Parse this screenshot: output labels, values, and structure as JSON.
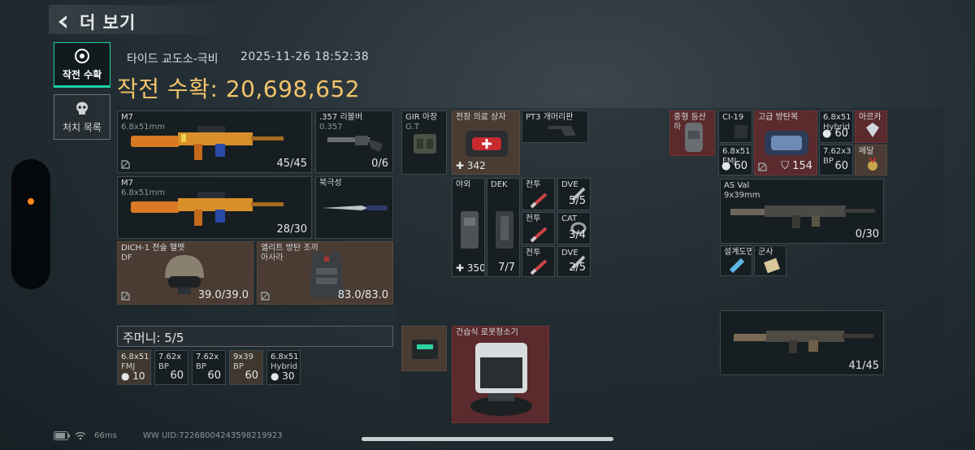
{
  "header": {
    "back_label": "더 보기"
  },
  "tabs": [
    {
      "label": "작전 수확",
      "active": true,
      "icon": "raid-harvest-icon"
    },
    {
      "label": "처치 목록",
      "active": false,
      "icon": "skull-icon"
    }
  ],
  "raid": {
    "location": "타이드 교도소-극비",
    "datetime": "2025-11-26 18:52:38",
    "harvest_label": "작전 수확:",
    "harvest_value": "20,698,652"
  },
  "left": {
    "weapon1": {
      "name": "M7",
      "caliber": "6.8x51mm",
      "ammo": "45/45"
    },
    "sidearm": {
      "name": ".357 리볼버",
      "sub": "0.357",
      "ammo": "0/6"
    },
    "weapon2": {
      "name": "M7",
      "caliber": "6.8x51mm",
      "ammo": "28/30"
    },
    "melee": {
      "name": "북극성"
    },
    "helmet": {
      "name": "DICH-1 전술 헬멧",
      "sub": "DF",
      "durability": "39.0/39.0"
    },
    "armor": {
      "name": "엘리트 방탄 조끼",
      "sub": "아사라",
      "durability": "83.0/83.0"
    },
    "pockets_label": "주머니: 5/5",
    "pockets": [
      {
        "name": "6.8x51",
        "sub": "FMJ",
        "count": "10"
      },
      {
        "name": "7.62x",
        "sub": "BP",
        "count": "60"
      },
      {
        "name": "7.62x",
        "sub": "BP",
        "count": "60"
      },
      {
        "name": "9x39",
        "sub": "BP",
        "count": "60"
      },
      {
        "name": "6.8x51",
        "sub": "Hybrid",
        "count": "30"
      }
    ]
  },
  "middle": {
    "rig": {
      "name": "GIR 아장",
      "sub": "G.T"
    },
    "medkit": {
      "name": "전장 의료 상자",
      "count": "342"
    },
    "pt3": {
      "name": "PT3 개머리판"
    },
    "field_kit": {
      "name": "야외",
      "count": "350"
    },
    "dek": {
      "name": "DEK",
      "count": "7/7"
    },
    "tact1": {
      "name": "전투"
    },
    "tact2": {
      "name": "전투"
    },
    "tact3": {
      "name": "전투"
    },
    "dve1": {
      "name": "DVE",
      "count": "5/5"
    },
    "cat": {
      "name": "CAT",
      "count": "3/4"
    },
    "dve2": {
      "name": "DVE",
      "count": "2/5"
    },
    "case_item": {
      "name": ""
    },
    "vacuum": {
      "name": "건습식 로봇청소기"
    }
  },
  "right": {
    "backpack": {
      "name": "중형 등산",
      "sub": "하"
    },
    "ci19": {
      "name": "CI-19"
    },
    "ammo_fmj": {
      "name": "6.8x51",
      "sub": "FMJ",
      "count": "60"
    },
    "armor_box": {
      "name": "고급 방탄복",
      "count": "154"
    },
    "ammo_hybrid": {
      "name": "6.8x51",
      "sub": "Hybrid",
      "count": "60"
    },
    "ammo_bp": {
      "name": "7.62x3",
      "sub": "BP",
      "count": "60"
    },
    "diamond": {
      "name": "아르카"
    },
    "medal": {
      "name": "메달"
    },
    "asval": {
      "name": "AS Val",
      "caliber": "9x39mm",
      "ammo": "0/30"
    },
    "blueprint": {
      "name": "설계도면"
    },
    "military": {
      "name": "군사"
    },
    "rifle2": {
      "ammo": "41/45"
    }
  },
  "status": {
    "ping": "66ms",
    "uid": "WW UID:72268004243598219923"
  },
  "colors": {
    "accent": "#1fd1a4",
    "harvest": "#f2c46b",
    "dot": "#ff8a1e"
  }
}
